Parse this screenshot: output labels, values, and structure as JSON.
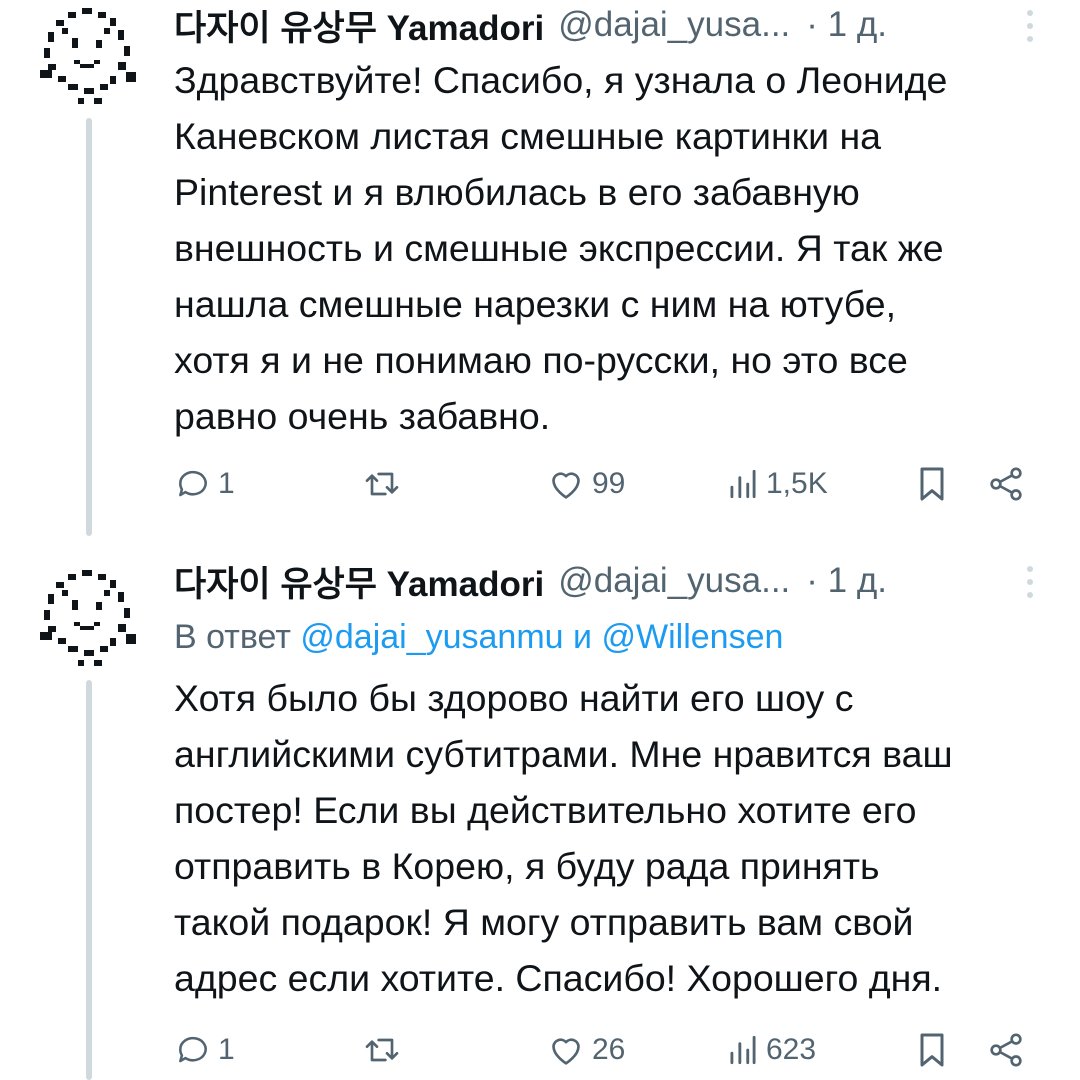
{
  "tweets": [
    {
      "display_name": "다자이 유상무 Yamadori",
      "handle": "@dajai_yusa...",
      "time": "· 1 д.",
      "reply_prefix": "",
      "reply_mentions": [],
      "text_lines": [
        "Здравствуйте! Спасибо, я узнала о Леониде",
        "Каневском листая смешные картинки на",
        "Pinterest и я влюбилась в его забавную",
        "внешность и смешные экспрессии. Я так же",
        "нашла смешные нарезки с ним на ютубе,",
        "хотя я и не понимаю по-русски, но это все",
        "равно очень забавно."
      ],
      "stats": {
        "replies": "1",
        "retweets": "",
        "likes": "99",
        "views": "1,5K"
      }
    },
    {
      "display_name": "다자이 유상무 Yamadori",
      "handle": "@dajai_yusa...",
      "time": "· 1 д.",
      "reply_prefix": "В ответ",
      "reply_mentions": [
        "@dajai_yusanmu",
        "и",
        "@Willensen"
      ],
      "text_lines": [
        "Хотя было бы здорово найти его шоу с",
        "английскими субтитрами. Мне нравится ваш",
        "постер! Если вы действительно хотите его",
        "отправить в Корею, я буду рада принять",
        "такой подарок! Я могу отправить вам свой",
        "адрес если хотите. Спасибо! Хорошего дня."
      ],
      "stats": {
        "replies": "1",
        "retweets": "",
        "likes": "26",
        "views": "623"
      }
    }
  ],
  "icons": {
    "reply": "speech-bubble-icon",
    "retweet": "retweet-icon",
    "like": "heart-icon",
    "views": "bar-chart-icon",
    "bookmark": "bookmark-icon",
    "share": "share-icon",
    "more": "vertical-dots-icon"
  },
  "colors": {
    "text": "#0f1419",
    "secondary": "#536471",
    "link": "#1d9bf0",
    "thread_line": "#cfd9de"
  }
}
